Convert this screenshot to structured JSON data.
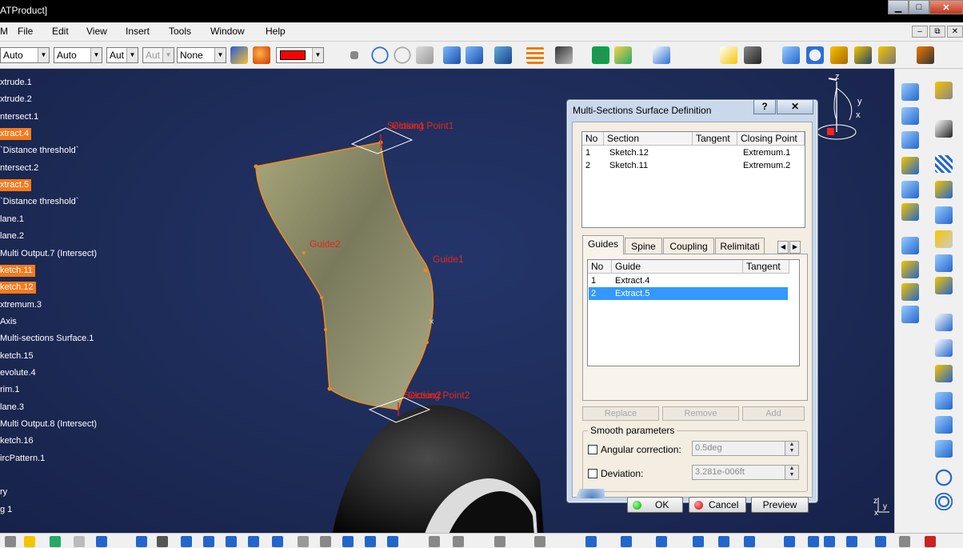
{
  "window": {
    "title": "ATProduct]",
    "btn_min": "▁",
    "btn_max": "□",
    "btn_close": "✕"
  },
  "menu": {
    "items": [
      "M",
      "File",
      "Edit",
      "View",
      "Insert",
      "Tools",
      "Window",
      "Help"
    ],
    "mdi_min": "–",
    "mdi_restore": "⧉",
    "mdi_close": "✕"
  },
  "toolbar": {
    "combo1": "Auto",
    "combo2": "Auto",
    "combo3": "Aut",
    "combo4": "Aut",
    "combo5": "None",
    "color_swatch": "#ff0000",
    "arrow": "▼"
  },
  "tree": {
    "items": [
      {
        "label": "xtrude.1",
        "hl": false
      },
      {
        "label": "xtrude.2",
        "hl": false
      },
      {
        "label": "ntersect.1",
        "hl": false
      },
      {
        "label": "xtract.4",
        "hl": true
      },
      {
        "label": "`Distance threshold`",
        "hl": false
      },
      {
        "label": "ntersect.2",
        "hl": false
      },
      {
        "label": "xtract.5",
        "hl": true
      },
      {
        "label": "`Distance threshold`",
        "hl": false
      },
      {
        "label": "lane.1",
        "hl": false
      },
      {
        "label": "lane.2",
        "hl": false
      },
      {
        "label": "Multi Output.7 (Intersect)",
        "hl": false
      },
      {
        "label": "ketch.11",
        "hl": true
      },
      {
        "label": "ketch.12",
        "hl": true
      },
      {
        "label": "xtremum.3",
        "hl": false
      },
      {
        "label": " Axis",
        "hl": false
      },
      {
        "label": "Multi-sections Surface.1",
        "hl": false
      },
      {
        "label": "ketch.15",
        "hl": false
      },
      {
        "label": "evolute.4",
        "hl": false
      },
      {
        "label": "rim.1",
        "hl": false
      },
      {
        "label": "lane.3",
        "hl": false
      },
      {
        "label": "Multi Output.8 (Intersect)",
        "hl": false
      },
      {
        "label": "ketch.16",
        "hl": false
      },
      {
        "label": "ircPattern.1",
        "hl": false
      },
      {
        "label": "",
        "hl": false
      },
      {
        "label": "ry",
        "hl": false
      },
      {
        "label": "g 1",
        "hl": false
      }
    ]
  },
  "viewport": {
    "label_section1": "Section1",
    "label_closing1": "Closing Point1",
    "label_section2": "Section2",
    "label_closing2": "Closing Point2",
    "label_guide1": "Guide1",
    "label_guide2": "Guide2",
    "axis_z": "z",
    "axis_y": "y",
    "axis_x": "x",
    "compass_z": "z",
    "compass_y": "y",
    "compass_x": "x"
  },
  "dialog": {
    "title": "Multi-Sections Surface Definition",
    "help": "?",
    "close": "✕",
    "sections_table": {
      "headers": [
        "No",
        "Section",
        "Tangent",
        "Closing Point"
      ],
      "rows": [
        [
          "1",
          "Sketch.12",
          "",
          "Extremum.1"
        ],
        [
          "2",
          "Sketch.11",
          "",
          "Extremum.2"
        ]
      ]
    },
    "tabs": [
      "Guides",
      "Spine",
      "Coupling",
      "Relimitati"
    ],
    "tab_prev": "◀",
    "tab_next": "▶",
    "guides_table": {
      "headers": [
        "No",
        "Guide",
        "Tangent"
      ],
      "rows": [
        [
          "1",
          "Extract.4",
          ""
        ],
        [
          "2",
          "Extract.5",
          ""
        ]
      ],
      "selected_row": 1
    },
    "btn_replace": "Replace",
    "btn_remove": "Remove",
    "btn_add": "Add",
    "smooth_title": "Smooth parameters",
    "angular_label": "Angular correction:",
    "angular_value": "0.5deg",
    "deviation_label": "Deviation:",
    "deviation_value": "3.281e-006ft",
    "spin_up": "▲",
    "spin_down": "▼",
    "ok": "OK",
    "cancel": "Cancel",
    "preview": "Preview"
  }
}
